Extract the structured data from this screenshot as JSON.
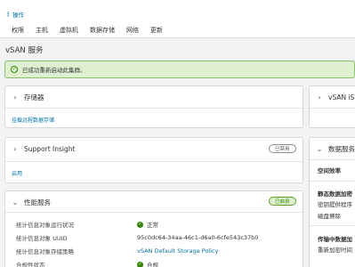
{
  "header": {
    "actions_label": "操作",
    "tabs": [
      "权限",
      "主机",
      "虚拟机",
      "数据存储",
      "网络",
      "更新"
    ]
  },
  "page_title": "vSAN 服务",
  "alert": {
    "message": "已成功重新启动此集群。"
  },
  "storage_card": {
    "title": "存储器",
    "link": "挂载远程数据存储"
  },
  "support_card": {
    "title": "Support Insight",
    "badge": "已禁用",
    "link": "启用"
  },
  "performance_card": {
    "title": "性能服务",
    "badge": "已启用",
    "rows": [
      {
        "label": "统计信息对象运行状况",
        "value": "正常",
        "status": "ok"
      },
      {
        "label": "统计信息对象 UUID",
        "value": "95c0dc64-34aa-46c1-d6a0-6cfe543c37b0"
      },
      {
        "label": "统计信息对象存储策略",
        "value": "vSAN Default Storage Policy",
        "link": true
      },
      {
        "label": "合规性状态",
        "value": "合规",
        "status": "ok"
      }
    ]
  },
  "right_panel": {
    "iscsi_title": "vSAN iS",
    "data_services_title": "数据服务",
    "space_efficiency": "空间效率",
    "static_encryption": "静态数据加密",
    "key_provider": "密钥提供程序",
    "disk_wipe": "磁盘擦除",
    "transit_encryption": "传输中数据加",
    "rekey_interval": "重新加密时间"
  },
  "colors": {
    "link": "#0072a3",
    "success": "#318700",
    "alert_bg": "#dff0d0"
  }
}
